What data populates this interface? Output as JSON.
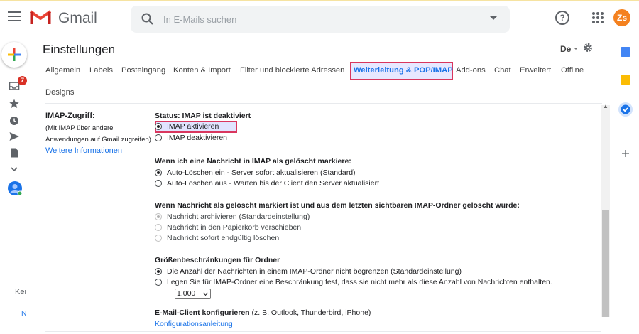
{
  "header": {
    "app_name": "Gmail",
    "search_placeholder": "In E-Mails suchen",
    "help_label": "?",
    "avatar_initials": "Zs"
  },
  "left_rail": {
    "inbox_badge": "7",
    "bottom_text_1": "Kei",
    "bottom_text_2": "N"
  },
  "settings": {
    "title": "Einstellungen",
    "lang": "De",
    "tabs": [
      "Allgemein",
      "Labels",
      "Posteingang",
      "Konten & Import",
      "Filter und blockierte Adressen",
      "Weiterleitung & POP/IMAP",
      "Add-ons",
      "Chat",
      "Erweitert",
      "Offline",
      "Designs"
    ]
  },
  "imap": {
    "label_title": "IMAP-Zugriff:",
    "label_note_1": "(Mit IMAP über andere",
    "label_note_2": "Anwendungen auf Gmail zugreifen)",
    "label_link": "Weitere Informationen",
    "status": "Status: IMAP ist deaktiviert",
    "enable": "IMAP aktivieren",
    "disable": "IMAP deaktivieren",
    "delete_title": "Wenn ich eine Nachricht in IMAP als gelöscht markiere:",
    "delete_opt_1": "Auto-Löschen ein - Server sofort aktualisieren (Standard)",
    "delete_opt_2": "Auto-Löschen aus - Warten bis der Client den Server aktualisiert",
    "expunge_title": "Wenn Nachricht als gelöscht markiert ist und aus dem letzten sichtbaren IMAP-Ordner gelöscht wurde:",
    "expunge_opt_1": "Nachricht archivieren (Standardeinstellung)",
    "expunge_opt_2": "Nachricht in den Papierkorb verschieben",
    "expunge_opt_3": "Nachricht sofort endgültig löschen",
    "size_title": "Größenbeschränkungen für Ordner",
    "size_opt_1": "Die Anzahl der Nachrichten in einem IMAP-Ordner nicht begrenzen (Standardeinstellung)",
    "size_opt_2": "Legen Sie für IMAP-Ordner eine Beschränkung fest, dass sie nicht mehr als diese Anzahl von Nachrichten enthalten.",
    "size_select": "1.000",
    "client_title": "E-Mail-Client konfigurieren",
    "client_note": "(z. B. Outlook, Thunderbird, iPhone)",
    "client_link": "Konfigurationsanleitung"
  }
}
